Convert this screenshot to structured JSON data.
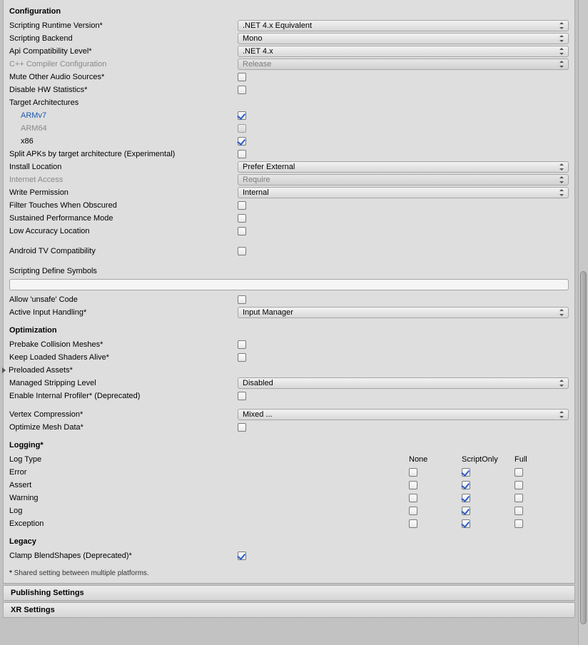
{
  "configuration": {
    "title": "Configuration",
    "scripting_runtime_label": "Scripting Runtime Version*",
    "scripting_runtime_value": ".NET 4.x Equivalent",
    "scripting_backend_label": "Scripting Backend",
    "scripting_backend_value": "Mono",
    "api_compat_label": "Api Compatibility Level*",
    "api_compat_value": ".NET 4.x",
    "cpp_config_label": "C++ Compiler Configuration",
    "cpp_config_value": "Release",
    "mute_audio_label": "Mute Other Audio Sources*",
    "disable_hw_label": "Disable HW Statistics*",
    "target_arch_label": "Target Architectures",
    "armv7_label": "ARMv7",
    "arm64_label": "ARM64",
    "x86_label": "x86",
    "split_apks_label": "Split APKs by target architecture (Experimental)",
    "install_location_label": "Install Location",
    "install_location_value": "Prefer External",
    "internet_access_label": "Internet Access",
    "internet_access_value": "Require",
    "write_permission_label": "Write Permission",
    "write_permission_value": "Internal",
    "filter_touches_label": "Filter Touches When Obscured",
    "sustained_perf_label": "Sustained Performance Mode",
    "low_accuracy_label": "Low Accuracy Location",
    "android_tv_label": "Android TV Compatibility",
    "scripting_define_label": "Scripting Define Symbols",
    "allow_unsafe_label": "Allow 'unsafe' Code",
    "active_input_label": "Active Input Handling*",
    "active_input_value": "Input Manager"
  },
  "optimization": {
    "title": "Optimization",
    "prebake_label": "Prebake Collision Meshes*",
    "keep_shaders_label": "Keep Loaded Shaders Alive*",
    "preloaded_label": "Preloaded Assets*",
    "stripping_label": "Managed Stripping Level",
    "stripping_value": "Disabled",
    "internal_profiler_label": "Enable Internal Profiler* (Deprecated)",
    "vertex_compression_label": "Vertex Compression*",
    "vertex_compression_value": "Mixed ...",
    "optimize_mesh_label": "Optimize Mesh Data*"
  },
  "logging": {
    "title": "Logging*",
    "header_type": "Log Type",
    "header_none": "None",
    "header_scriptonly": "ScriptOnly",
    "header_full": "Full",
    "rows": [
      {
        "label": "Error"
      },
      {
        "label": "Assert"
      },
      {
        "label": "Warning"
      },
      {
        "label": "Log"
      },
      {
        "label": "Exception"
      }
    ]
  },
  "legacy": {
    "title": "Legacy",
    "clamp_label": "Clamp BlendShapes (Deprecated)*"
  },
  "footnote_star": "*",
  "footnote_text": " Shared setting between multiple platforms.",
  "publishing_title": "Publishing Settings",
  "xr_title": "XR Settings"
}
